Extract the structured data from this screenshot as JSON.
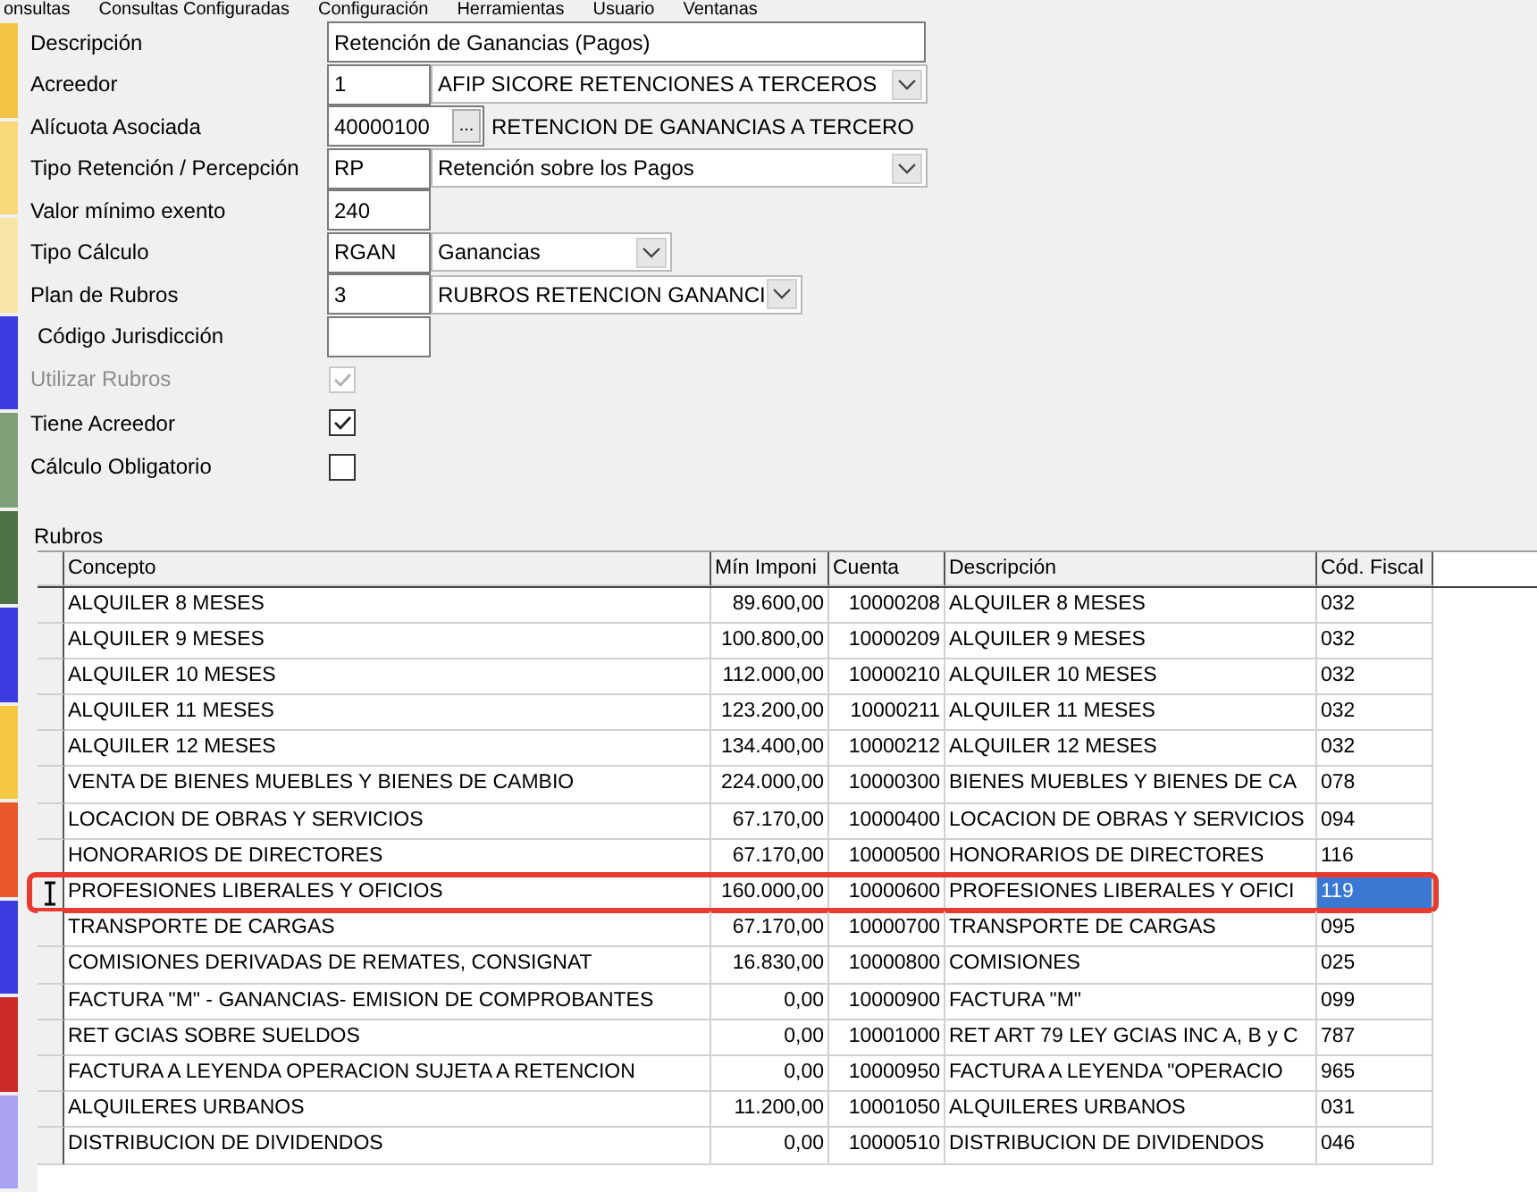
{
  "menu_bar": [
    "onsultas",
    "Consultas Configuradas",
    "Configuración",
    "Herramientas",
    "Usuario",
    "Ventanas"
  ],
  "side_strip": [
    {
      "color": "#f2c443"
    },
    {
      "color": "#f7d979"
    },
    {
      "color": "#f9e5a8"
    },
    {
      "color": "#3b3be0"
    },
    {
      "color": "#7f9f78"
    },
    {
      "color": "#4f7247"
    },
    {
      "color": "#3b3be0"
    },
    {
      "color": "#f5c842"
    },
    {
      "color": "#e8582a"
    },
    {
      "color": "#3b3be0"
    },
    {
      "color": "#cc2a2a"
    },
    {
      "color": "#a9a2f2"
    }
  ],
  "form": [
    {
      "kind": "text",
      "label": "Descripción",
      "value": "Retención de Ganancias (Pagos)"
    },
    {
      "kind": "code_combo",
      "label": "Acreedor",
      "value": "1",
      "option": "AFIP SICORE RETENCIONES A TERCEROS"
    },
    {
      "kind": "code_lookup",
      "label": "Alícuota Asociada",
      "value": "40000100",
      "button": "...",
      "description": "RETENCION DE GANANCIAS A TERCERO"
    },
    {
      "kind": "code_combo",
      "label": "Tipo Retención / Percepción",
      "value": "RP",
      "option": "Retención sobre los Pagos"
    },
    {
      "kind": "code",
      "label": "Valor mínimo exento",
      "value": "240"
    },
    {
      "kind": "code_combo",
      "label": "Tipo Cálculo",
      "value": "RGAN",
      "option": "Ganancias"
    },
    {
      "kind": "code_combo",
      "label": "Plan de Rubros",
      "value": "3",
      "option": "RUBROS RETENCION GANANCI"
    },
    {
      "kind": "code",
      "label": "Código Jurisdicción"
    },
    {
      "kind": "checkbox",
      "label": "Utilizar Rubros",
      "checked": true,
      "disabled": true
    },
    {
      "kind": "checkbox",
      "label": "Tiene Acreedor",
      "checked": true,
      "disabled": false
    },
    {
      "kind": "checkbox",
      "label": "Cálculo Obligatorio",
      "checked": false,
      "disabled": false
    }
  ],
  "rubros": {
    "title": "Rubros",
    "columns": [
      "Concepto",
      "Mín Imponi",
      "Cuenta",
      "Descripción",
      "Cód. Fiscal"
    ],
    "rows": [
      {
        "cells": [
          "ALQUILER 8 MESES",
          "89.600,00",
          "10000208",
          "ALQUILER 8 MESES",
          "032"
        ],
        "selected": false
      },
      {
        "cells": [
          "ALQUILER 9 MESES",
          "100.800,00",
          "10000209",
          "ALQUILER 9 MESES",
          "032"
        ],
        "selected": false
      },
      {
        "cells": [
          "ALQUILER 10 MESES",
          "112.000,00",
          "10000210",
          "ALQUILER 10 MESES",
          "032"
        ],
        "selected": false
      },
      {
        "cells": [
          "ALQUILER 11 MESES",
          "123.200,00",
          "10000211",
          "ALQUILER 11 MESES",
          "032"
        ],
        "selected": false
      },
      {
        "cells": [
          "ALQUILER 12 MESES",
          "134.400,00",
          "10000212",
          "ALQUILER 12 MESES",
          "032"
        ],
        "selected": false
      },
      {
        "cells": [
          "VENTA DE BIENES MUEBLES Y BIENES DE CAMBIO",
          "224.000,00",
          "10000300",
          "BIENES MUEBLES Y BIENES DE CA",
          "078"
        ],
        "selected": false
      },
      {
        "cells": [
          "LOCACION DE OBRAS Y SERVICIOS",
          "67.170,00",
          "10000400",
          "LOCACION DE OBRAS Y SERVICIOS",
          "094"
        ],
        "selected": false
      },
      {
        "cells": [
          "HONORARIOS DE DIRECTORES",
          "67.170,00",
          "10000500",
          "HONORARIOS DE DIRECTORES",
          "116"
        ],
        "selected": false
      },
      {
        "cells": [
          "PROFESIONES LIBERALES Y OFICIOS",
          "160.000,00",
          "10000600",
          "PROFESIONES LIBERALES Y OFICI",
          "119"
        ],
        "selected": true
      },
      {
        "cells": [
          "TRANSPORTE DE CARGAS",
          "67.170,00",
          "10000700",
          "TRANSPORTE DE CARGAS",
          "095"
        ],
        "selected": false
      },
      {
        "cells": [
          "COMISIONES DERIVADAS DE REMATES, CONSIGNAT",
          "16.830,00",
          "10000800",
          "COMISIONES",
          "025"
        ],
        "selected": false
      },
      {
        "cells": [
          "FACTURA \"M\" - GANANCIAS- EMISION DE COMPROBANTES",
          "0,00",
          "10000900",
          "FACTURA \"M\"",
          "099"
        ],
        "selected": false
      },
      {
        "cells": [
          "RET GCIAS SOBRE SUELDOS",
          "0,00",
          "10001000",
          "RET ART 79 LEY GCIAS INC A, B y C",
          "787"
        ],
        "selected": false
      },
      {
        "cells": [
          "FACTURA A LEYENDA OPERACION SUJETA A RETENCION",
          "0,00",
          "10000950",
          "FACTURA A LEYENDA \"OPERACIO",
          "965"
        ],
        "selected": false
      },
      {
        "cells": [
          "ALQUILERES URBANOS",
          "11.200,00",
          "10001050",
          "ALQUILERES URBANOS",
          "031"
        ],
        "selected": false
      },
      {
        "cells": [
          "DISTRIBUCION DE DIVIDENDOS",
          "0,00",
          "10000510",
          "DISTRIBUCION DE DIVIDENDOS",
          "046"
        ],
        "selected": false
      }
    ]
  }
}
